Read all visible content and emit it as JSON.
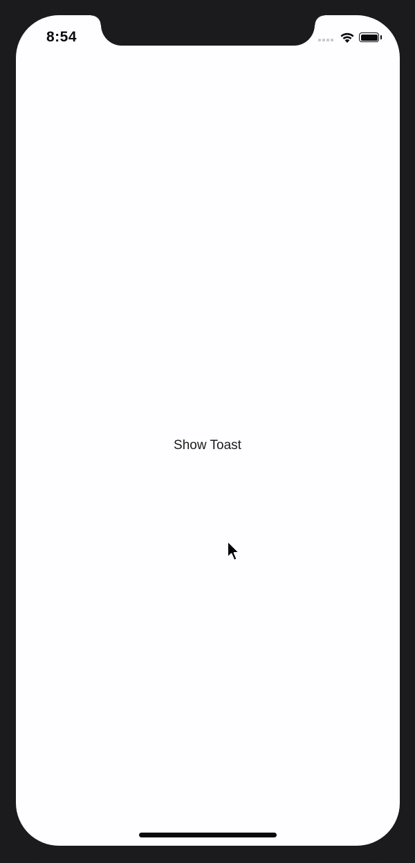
{
  "status_bar": {
    "time": "8:54",
    "icons": [
      "cellular-signal-icon",
      "wifi-icon",
      "battery-icon"
    ]
  },
  "main": {
    "button_label": "Show Toast"
  },
  "colors": {
    "screen_background": "#fefdff",
    "device_frame": "#1b1a1d",
    "text": "#1a1a1a"
  }
}
